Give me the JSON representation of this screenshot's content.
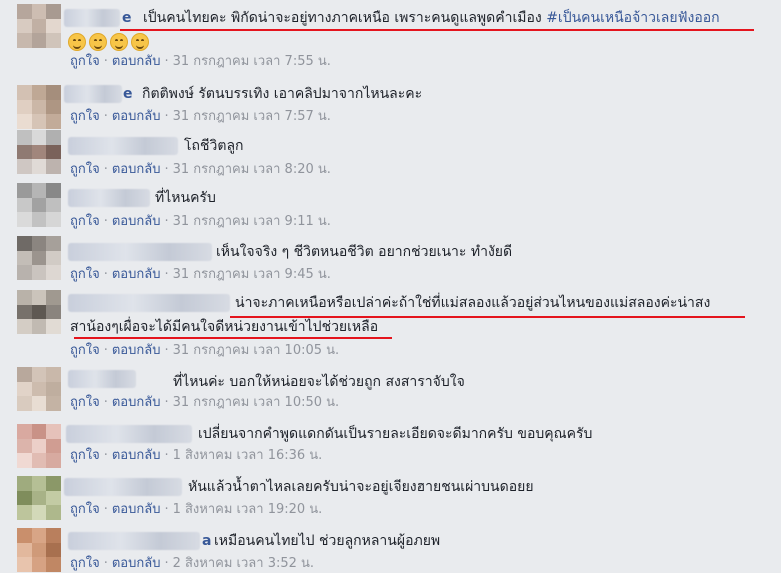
{
  "colors": {
    "background": "#e9ebee",
    "link": "#385898",
    "meta": "#90949c",
    "text": "#1d2129",
    "highlight_underline": "#e4141d"
  },
  "actions": {
    "like": "ถูกใจ",
    "reply": "ตอบกลับ",
    "separator": "·"
  },
  "comments": [
    {
      "name_tail": "e",
      "text": "เป็นคนไทยคะ พิกัดน่าจะอยู่ทางภาคเหนือ เพราะคนดูแลพูดคำเมือง",
      "hashtag": "#เป็นคนเหนือจ้าวเลยฟังออก",
      "emoji": [
        "smiling-face-icon",
        "smiling-face-icon",
        "smiling-face-icon",
        "smiling-face-icon"
      ],
      "timestamp": "31 กรกฎาคม เวลา 7:55 น."
    },
    {
      "name_tail": "e",
      "text": "กิตติพงษ์ รัตนบรรเทิง เอาคลิปมาจากไหนละคะ",
      "timestamp": "31 กรกฎาคม เวลา 7:57 น."
    },
    {
      "text": "โถชีวิตลูก",
      "timestamp": "31 กรกฎาคม เวลา 8:20 น."
    },
    {
      "text": "ที่ไหนครับ",
      "timestamp": "31 กรกฎาคม เวลา 9:11 น."
    },
    {
      "text": "เห็นใจจริง ๆ ชีวิตหนอชีวิต อยากช่วยเนาะ ทำงัยดี",
      "timestamp": "31 กรกฎาคม เวลา 9:45 น."
    },
    {
      "text_line1": "น่าจะภาคเหนือหรือเปล่าค่ะถ้าใช่ที่แม่สลองแล้วอยู่ส่วนไหนของแม่สลองค่ะน่าสง",
      "text_line2": "สาน้องๆเผื่อจะได้มีคนใจดีหน่วยงานเข้าไปช่วยเหลือ",
      "timestamp": "31 กรกฎาคม เวลา 10:05 น."
    },
    {
      "text": "ที่ไหนค่ะ บอกให้หน่อยจะได้ช่วยถูก สงสาราจับใจ",
      "timestamp": "31 กรกฎาคม เวลา 10:50 น."
    },
    {
      "text": "เปลี่ยนจากคำพูดแดกดันเป็นรายละเอียดจะดีมากครับ ขอบคุณครับ",
      "timestamp": "1 สิงหาคม เวลา 16:36 น."
    },
    {
      "text": "หันแล้วน้ำตาไหลเลยครับน่าจะอยู่เจียงฮายชนเผ่าบนดอยย",
      "timestamp": "1 สิงหาคม เวลา 19:20 น."
    },
    {
      "name_tail": "a",
      "text": "เหมือนคนไทยไป ช่วยลูกหลานผู้อภยพ",
      "timestamp": "2 สิงหาคม เวลา 3:52 น."
    }
  ]
}
